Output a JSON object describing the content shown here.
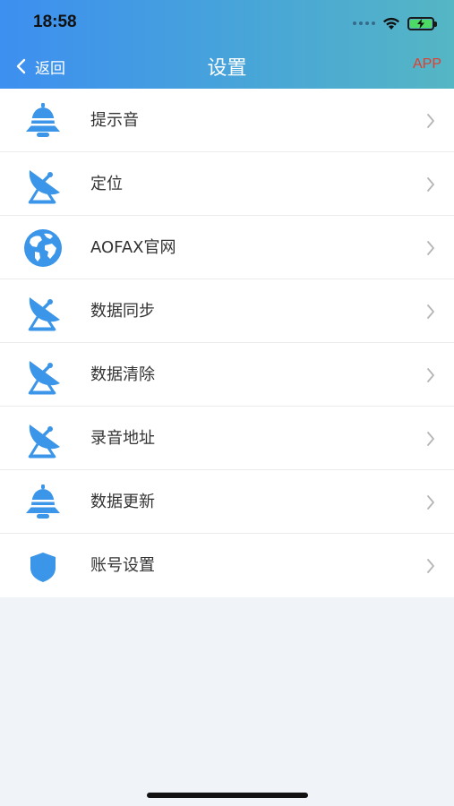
{
  "status_bar": {
    "time": "18:58"
  },
  "nav": {
    "back_label": "返回",
    "title": "设置",
    "right_link": "APP"
  },
  "colors": {
    "accent": "#3d8ff0",
    "icon": "#3b95e8",
    "app_link": "#e23d2e"
  },
  "settings": [
    {
      "label": "提示音",
      "icon": "bell-icon"
    },
    {
      "label": "定位",
      "icon": "satellite-dish-icon"
    },
    {
      "label": "AOFAX官网",
      "icon": "globe-icon"
    },
    {
      "label": "数据同步",
      "icon": "satellite-dish-icon"
    },
    {
      "label": "数据清除",
      "icon": "satellite-dish-icon"
    },
    {
      "label": "录音地址",
      "icon": "satellite-dish-icon"
    },
    {
      "label": "数据更新",
      "icon": "bell-icon"
    },
    {
      "label": "账号设置",
      "icon": "shield-icon"
    }
  ]
}
